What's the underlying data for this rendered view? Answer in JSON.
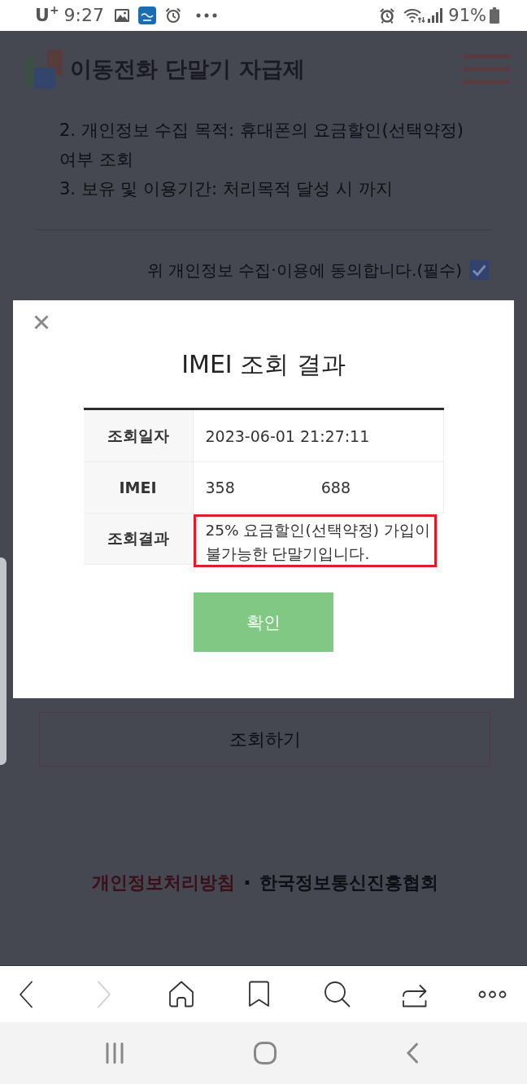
{
  "status_bar": {
    "carrier": "U$^{+}$",
    "time": "9:27",
    "battery": "91%"
  },
  "header": {
    "title": "이동전화 단말기 자급제"
  },
  "notice": {
    "items": [
      {
        "lines": [
          "2. 개인정보 수집 목적: 휴대폰의 요금할인(선택약정)",
          "여부 조회"
        ]
      },
      {
        "lines": [
          "3. 보유 및 이용기간: 처리목적 달성 시 까지"
        ]
      }
    ]
  },
  "agreement": {
    "label": "위 개인정보 수집·이용에 동의합니다.(필수)",
    "checked": true
  },
  "lookup_button": {
    "label": "조회하기"
  },
  "footer": {
    "links": [
      {
        "label": "개인정보처리방침",
        "kind": "policy"
      },
      {
        "label": "한국정보통신진흥협회",
        "kind": "org"
      }
    ],
    "separator": "·"
  },
  "modal": {
    "title": "IMEI 조회 결과",
    "rows": [
      {
        "label": "조회일자",
        "kind": "text",
        "values": [
          "2023-06-01 21:27:11"
        ],
        "highlighted": false
      },
      {
        "label": "IMEI",
        "kind": "masked",
        "values": [
          "358",
          "688"
        ],
        "highlighted": false
      },
      {
        "label": "조회결과",
        "kind": "lines",
        "values": [
          "25% 요금할인(선택약정) 가입이",
          "불가능한 단말기입니다."
        ],
        "highlighted": true
      }
    ],
    "confirm_button": {
      "label": "확인"
    }
  },
  "browser_toolbar": {
    "items": [
      {
        "kind": "back",
        "disabled": false
      },
      {
        "kind": "forward",
        "disabled": true
      },
      {
        "kind": "home",
        "disabled": false
      },
      {
        "kind": "bookmarks",
        "disabled": false
      },
      {
        "kind": "search",
        "disabled": false
      },
      {
        "kind": "share",
        "disabled": false
      },
      {
        "kind": "more",
        "disabled": false
      }
    ]
  }
}
